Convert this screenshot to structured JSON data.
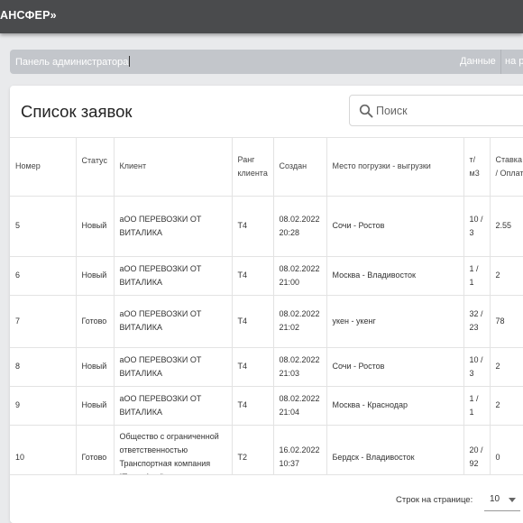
{
  "app": {
    "brand": "АНСФЕР»"
  },
  "breadcrumb": {
    "current": "Панель администратора",
    "data_link": "Данные",
    "next_link": "на р"
  },
  "card": {
    "title": "Список заявок",
    "search_placeholder": "Поиск"
  },
  "table": {
    "headers": {
      "number": "Номер",
      "status": "Статус",
      "client": "Клиент",
      "rank": "Ранг клиента",
      "created": "Создан",
      "route": "Место погрузки - выгрузки",
      "weight": "т/ м3",
      "rate": "Ставка К / Оплата"
    },
    "rows": [
      {
        "number": "5",
        "status": "Новый",
        "client": "аОО ПЕРЕВОЗКИ ОТ ВИТАЛИКА",
        "rank": "Т4",
        "created": "08.02.2022 20:28",
        "route": "Сочи - Ростов",
        "weight": "10 / 3",
        "rate": "2.55"
      },
      {
        "number": "6",
        "status": "Новый",
        "client": "аОО ПЕРЕВОЗКИ ОТ ВИТАЛИКА",
        "rank": "Т4",
        "created": "08.02.2022 21:00",
        "route": "Москва - Владивосток",
        "weight": "1 / 1",
        "rate": "2"
      },
      {
        "number": "7",
        "status": "Готово",
        "client": "аОО ПЕРЕВОЗКИ ОТ ВИТАЛИКА",
        "rank": "Т4",
        "created": "08.02.2022 21:02",
        "route": "укен - укенг",
        "weight": "32 / 23",
        "rate": "78"
      },
      {
        "number": "8",
        "status": "Новый",
        "client": "аОО ПЕРЕВОЗКИ ОТ ВИТАЛИКА",
        "rank": "Т4",
        "created": "08.02.2022 21:03",
        "route": "Сочи - Ростов",
        "weight": "10 / 3",
        "rate": "2"
      },
      {
        "number": "9",
        "status": "Новый",
        "client": "аОО ПЕРЕВОЗКИ ОТ ВИТАЛИКА",
        "rank": "Т4",
        "created": "08.02.2022 21:04",
        "route": "Москва - Краснодар",
        "weight": "1 / 1",
        "rate": "2"
      },
      {
        "number": "10",
        "status": "Готово",
        "client": "Общество с ограниченной ответственностью Транспортная компания \"Трансфер\"",
        "rank": "Т2",
        "created": "16.02.2022 10:37",
        "route": "Бердск - Владивосток",
        "weight": "20 / 92",
        "rate": "0"
      }
    ]
  },
  "pagination": {
    "rows_per_page_label": "Строк на странице:",
    "rows_per_page_value": "10"
  },
  "colors": {
    "topbar": "#4a4b4d",
    "breadcrumb_bg": "#c3c6cb",
    "page_bg": "#e9eaec"
  }
}
